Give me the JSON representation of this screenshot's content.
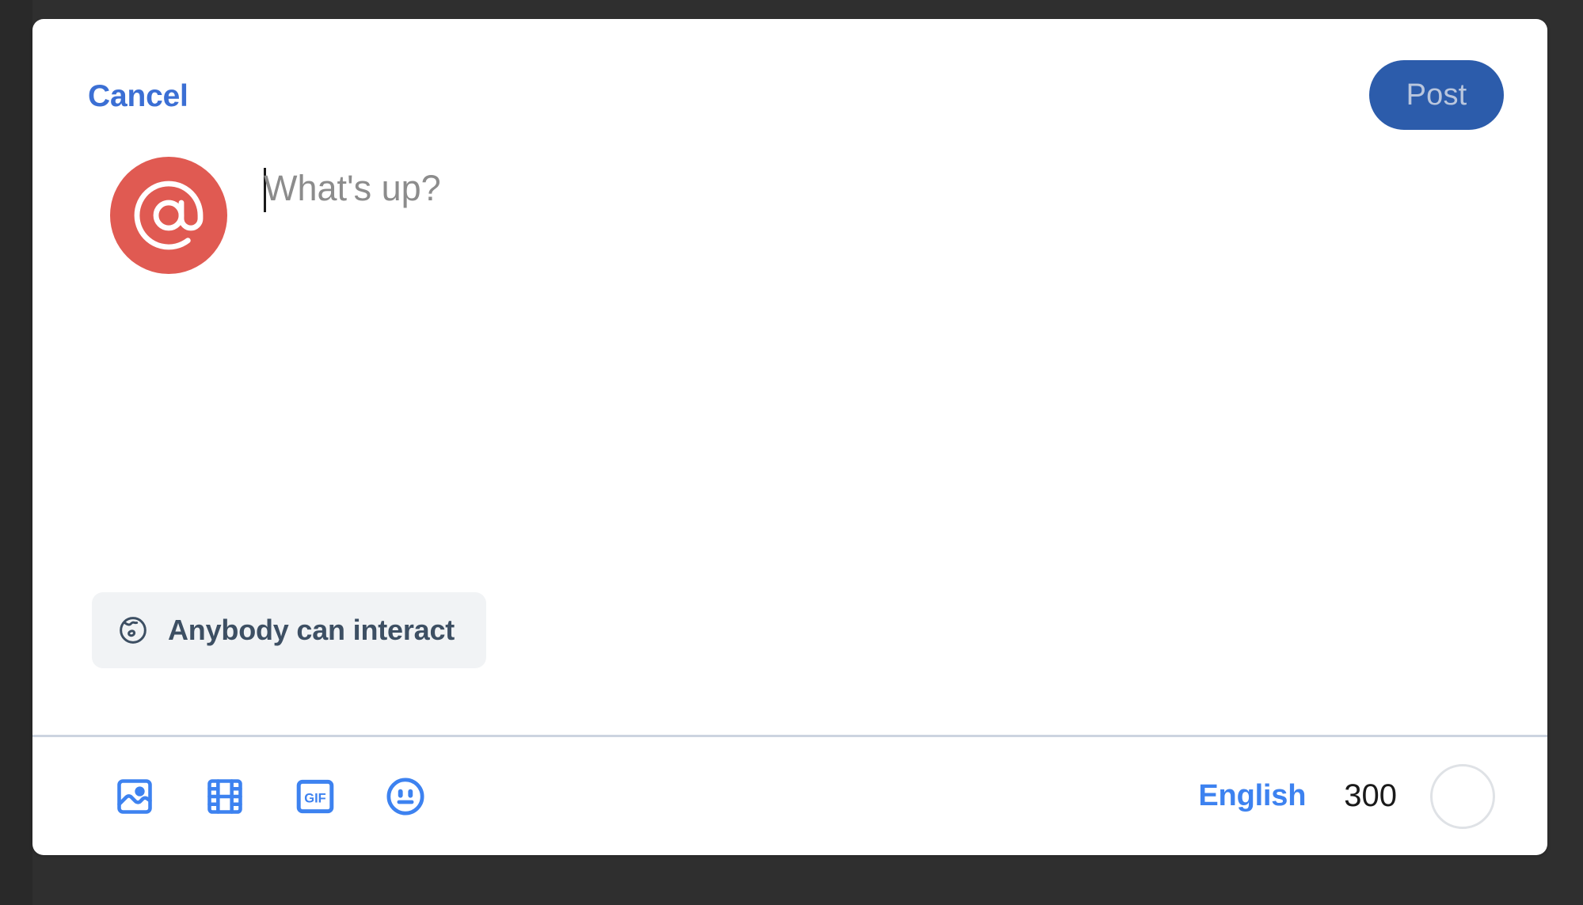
{
  "theme": {
    "backdrop_color": "#2f2f2f",
    "card_background": "#ffffff",
    "accent_blue": "#3d82f0",
    "cancel_blue": "#3b6fd4",
    "post_button_bg": "#2c5cab",
    "post_button_text_color": "#b9c6dd",
    "avatar_bg": "#e05a52",
    "chip_bg": "#f1f3f5",
    "chip_text_color": "#3d4f63",
    "divider_color": "#ccd4e0",
    "placeholder_color": "#8c8c8c",
    "progress_ring_color": "#dfe2e6"
  },
  "header": {
    "cancel_label": "Cancel",
    "post_label": "Post"
  },
  "compose": {
    "avatar_icon": "at-sign-icon",
    "avatar_glyph": "@",
    "placeholder": "What's up?",
    "value": "",
    "caret_visible": true
  },
  "audience": {
    "icon": "globe-icon",
    "label": "Anybody can interact"
  },
  "toolbar": {
    "actions": [
      {
        "name": "add-image-button",
        "icon": "image-icon",
        "label": "Add image"
      },
      {
        "name": "add-video-button",
        "icon": "film-icon",
        "label": "Add video"
      },
      {
        "name": "add-gif-button",
        "icon": "gif-icon",
        "label": "GIF"
      },
      {
        "name": "add-emoji-button",
        "icon": "emoji-smiley-icon",
        "label": "Add emoji"
      }
    ],
    "gif_glyph": "GIF",
    "language_label": "English",
    "char_count": "300",
    "progress_ring": {
      "name": "char-progress-ring",
      "percent": 0
    }
  }
}
